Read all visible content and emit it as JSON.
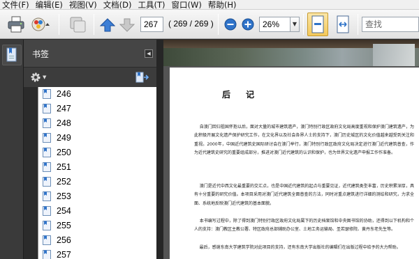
{
  "menu": [
    "文件(F)",
    "编辑(E)",
    "视图(V)",
    "文档(D)",
    "工具(T)",
    "窗口(W)",
    "帮助(H)"
  ],
  "toolbar": {
    "current_page": "267",
    "page_total": "( 269 / 269 )",
    "zoom": "26%",
    "search_placeholder": "查找"
  },
  "panel": {
    "title": "书签",
    "bookmarks": [
      "246",
      "247",
      "248",
      "249",
      "250",
      "251",
      "252",
      "253",
      "254",
      "255",
      "256",
      "257"
    ]
  },
  "document": {
    "heading": "后 记",
    "paragraphs": [
      "    自澳门回归祖国怀抱以后，面对大量的城市建筑遗产，澳门特别行政区政府文化局高度重视和保护澳门建筑遗产，为此积极开展文化遗产保护研究工作，在文化界以及社会各界人士的支持下，澳门历史城区的文化价值越来越受到关注和重视。2000年，中国近代建筑史国际研讨会在澳门举行，澳门特别行政区政府文化局决定进行澳门近代建筑普查，作为近代建筑史研究的重要组成部分，推进对澳门近代建筑的认识和保护，也为世界文化遗产申报工作作准备。",
      "    澳门是近代中西文化最重要的交汇点，也是中国近代建筑的起点与重要见证，近代建筑类型丰富，历史积累深厚，具有十分重要的研究价值。本项目采用对澳门近代建筑全面普查的方法，同时对重点建筑进行详细的测绘和研究，力求全面、系统地反映澳门近代建筑的基本面貌。",
      "    本书编写过程中，除了得到澳门特别行政区政府文化局属下的历史档案馆和中央图书馆的协助，还得到以下机构和个人的支持：澳门教区主教公署、特区政府总部辅助办公室、土地工务运输局、圣若瑟修院、黄丹东老先生等。",
      "    最后，感谢东南大学建筑学院对此项目的支持，还有东南大学出版社的编辑们在出版过程中给予的大力帮助。"
    ]
  },
  "colors": {
    "panel_bg": "#3c3c3c",
    "list_bg": "#ffffff",
    "doc_bg": "#545454",
    "accent": "#2a6fc9"
  },
  "icons": [
    "print-icon",
    "upload-icon",
    "hand-icon",
    "page-up-icon",
    "page-down-icon",
    "zoom-out-icon",
    "zoom-in-icon",
    "fit-page-icon",
    "fit-width-icon",
    "bookmarks-icon",
    "gear-icon",
    "bookmark-options-icon",
    "bookmark-icon"
  ]
}
